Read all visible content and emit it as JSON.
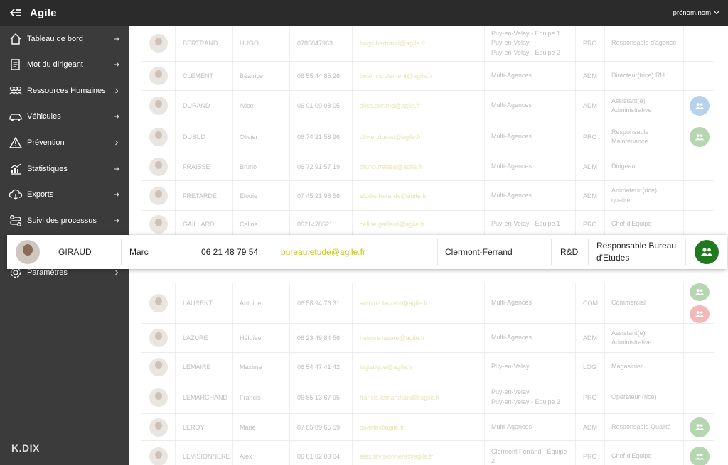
{
  "app": {
    "title": "Agile",
    "user": "prénom.nom",
    "logo": "K.DIX"
  },
  "colors": {
    "accent": "#1f7a1f",
    "email": "#c9c700",
    "badge_blue": "#4a8fd1",
    "badge_green": "#4a9a3f",
    "badge_red": "#e25050"
  },
  "sidebar": {
    "items": [
      {
        "label": "Tableau de bord",
        "icon": "home-icon"
      },
      {
        "label": "Mot du dirigeant",
        "icon": "document-icon"
      },
      {
        "label": "Ressources Humaines",
        "icon": "people-icon"
      },
      {
        "label": "Véhicules",
        "icon": "car-icon"
      },
      {
        "label": "Prévention",
        "icon": "warning-icon"
      },
      {
        "label": "Statistiques",
        "icon": "chart-icon"
      },
      {
        "label": "Exports",
        "icon": "download-icon"
      },
      {
        "label": "Suivi des processus",
        "icon": "process-icon"
      },
      {
        "label": "Paramètres",
        "icon": "gear-icon"
      }
    ]
  },
  "rows": [
    {
      "name": "BERTRAND",
      "first": "HUGO",
      "phone": "0785847963",
      "email": "hugo.bertrand@agile.fr",
      "site": "Puy-en-Velay - Équipe 1\nPuy-en-Velay\nPuy-en-Velay - Équipe 2",
      "dept": "PRO",
      "role": "Responsable d'agence",
      "badges": []
    },
    {
      "name": "CLEMENT",
      "first": "Béatrice",
      "phone": "06 55 44 85 26",
      "email": "beatrice.clement@agile.fr",
      "site": "Multi-Agences",
      "dept": "ADM",
      "role": "Directeur(trice) RH",
      "badges": []
    },
    {
      "name": "DURAND",
      "first": "Alice",
      "phone": "06 01 09 08 05",
      "email": "alice.durand@agile.fr",
      "site": "Multi-Agences",
      "dept": "ADM",
      "role": "Assistant(e)\nAdministrative",
      "badges": [
        "blue"
      ]
    },
    {
      "name": "DUSUD",
      "first": "Olivier",
      "phone": "06 74 21 58 96",
      "email": "olivier.dusud@agile.fr",
      "site": "Multi-Agences",
      "dept": "PRO",
      "role": "Responsable\nMaintenance",
      "badges": [
        "green"
      ]
    },
    {
      "name": "FRAISSE",
      "first": "Bruno",
      "phone": "06 72 91 57 19",
      "email": "bruno.fraisse@agile.fr",
      "site": "Multi-Agences",
      "dept": "ADM",
      "role": "Dirigeant",
      "badges": []
    },
    {
      "name": "FRETARDE",
      "first": "Elodie",
      "phone": "07 45 21 98 56",
      "email": "elodie.fretarde@agile.fr",
      "site": "Multi-Agences",
      "dept": "ADM",
      "role": "Animateur (rice)\nqualité",
      "badges": []
    },
    {
      "name": "GAILLARD",
      "first": "Céline",
      "phone": "0621478521",
      "email": "celine.gaillard@agile.fr",
      "site": "Puy-en-Velay - Équipe 1",
      "dept": "PRO",
      "role": "Chef d'Equipe",
      "badges": []
    },
    {
      "name": "LAURENT",
      "first": "Antoine",
      "phone": "06 58 94 76 31",
      "email": "antoine.laurent@agile.fr",
      "site": "Multi-Agences",
      "dept": "COM",
      "role": "Commercial",
      "badges": [
        "green",
        "red"
      ]
    },
    {
      "name": "LAZURE",
      "first": "Héloïse",
      "phone": "06 23 49 84 56",
      "email": "heloise.lazure@agile.fr",
      "site": "Multi-Agences",
      "dept": "ADM",
      "role": "Assistant(e)\nAdministrative",
      "badges": []
    },
    {
      "name": "LEMAIRE",
      "first": "Maxime",
      "phone": "06 54 47 41 42",
      "email": "logistique@agile.fr",
      "site": "Puy-en-Velay",
      "dept": "LOG",
      "role": "Magasinier",
      "badges": []
    },
    {
      "name": "LEMARCHAND",
      "first": "Francis",
      "phone": "06 85 13 67 95",
      "email": "francis.lemarchand@agile.fr",
      "site": "Puy-en-Velay\nPuy-en-Velay - Équipe 2",
      "dept": "PRO",
      "role": "Opérateur (rice)",
      "badges": []
    },
    {
      "name": "LEROY",
      "first": "Marie",
      "phone": "07 85 89 65 59",
      "email": "qualite@agile.fr",
      "site": "Multi-Agences",
      "dept": "ADM",
      "role": "Responsable Qualité",
      "badges": [
        "green"
      ]
    },
    {
      "name": "LEVISIONNERE",
      "first": "Alex",
      "phone": "06 01 02 03 04",
      "email": "alex.levisionnere@agile.fr",
      "site": "Clermont Ferrand - Équipe\n2",
      "dept": "PRO",
      "role": "Chef d'Equipe",
      "badges": [
        "green"
      ]
    }
  ],
  "highlight": {
    "name": "GIRAUD",
    "first": "Marc",
    "phone": "06 21 48 79 54",
    "email": "bureau.etude@agile.fr",
    "site": "Clermont-Ferrand",
    "dept": "R&D",
    "role": "Responsable Bureau\nd'Etudes",
    "badge": "green"
  }
}
